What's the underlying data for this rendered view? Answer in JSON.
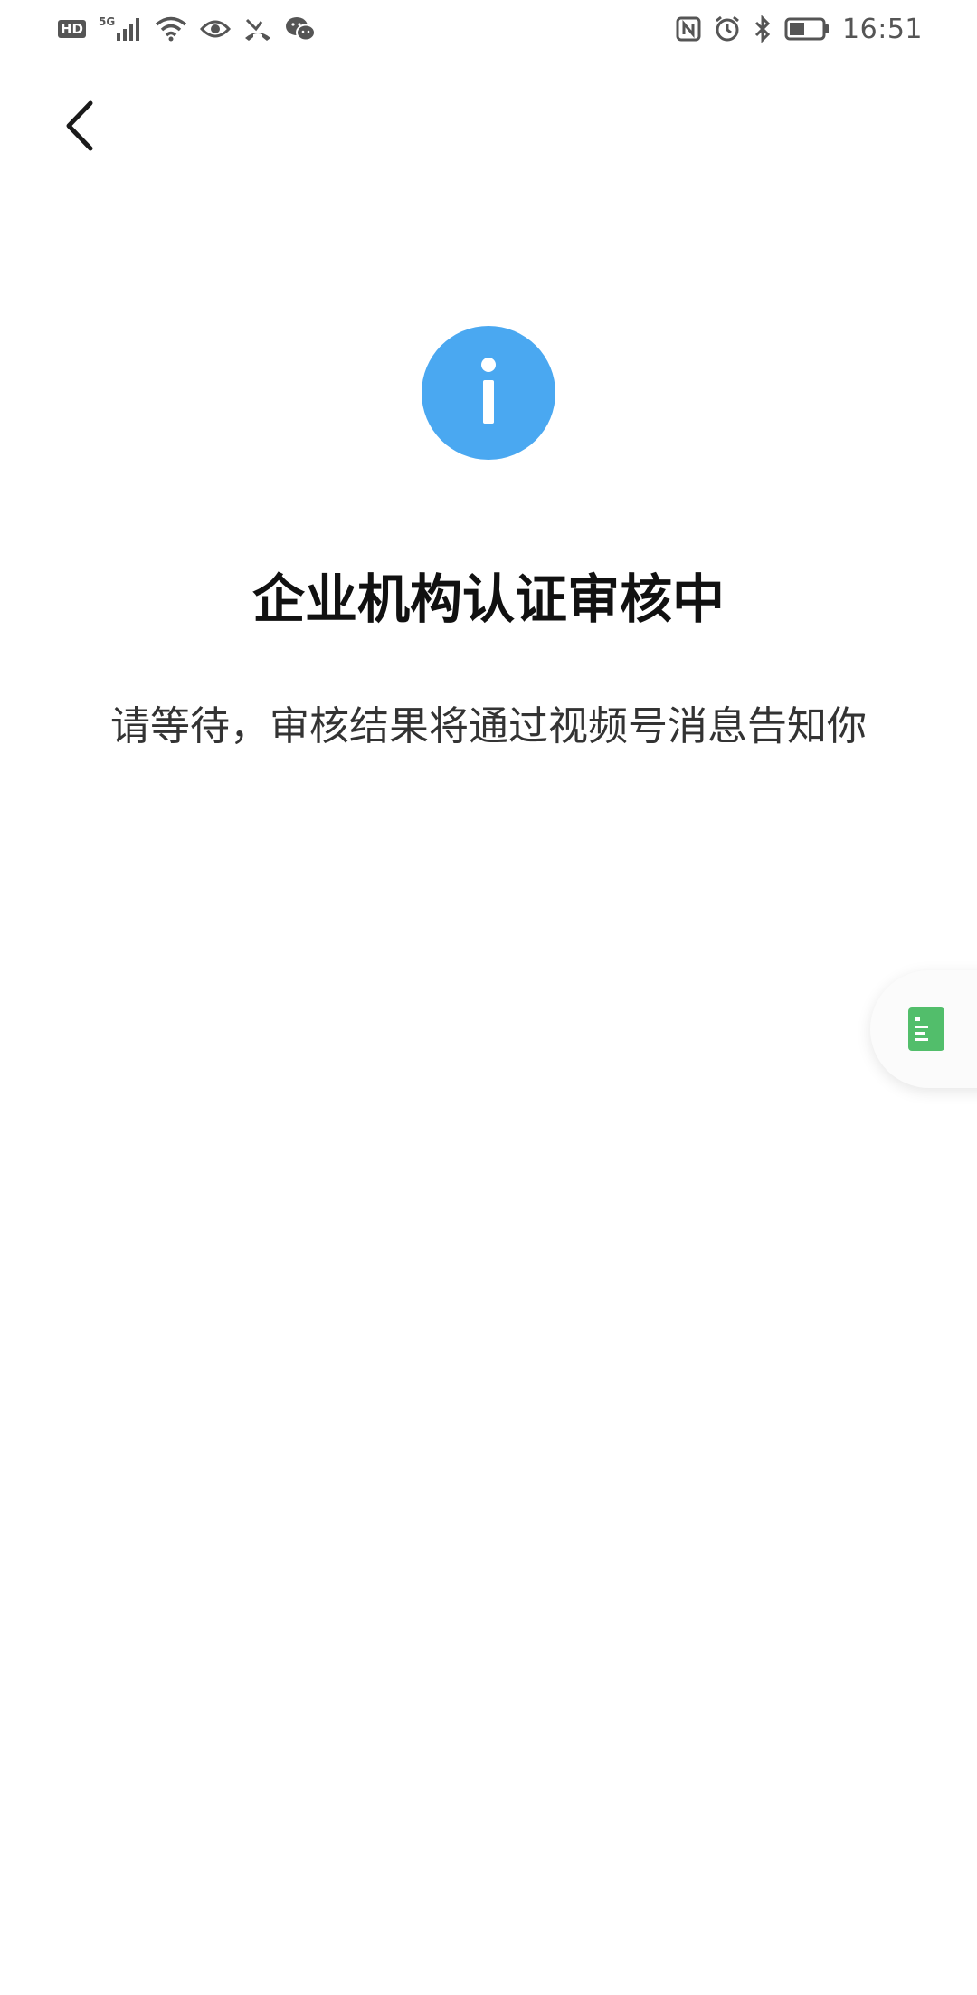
{
  "status_bar": {
    "hd_label": "HD",
    "network_label": "5G",
    "time": "16:51",
    "icons": [
      "signal-icon",
      "wifi-icon",
      "eye-icon",
      "missed-call-icon",
      "wechat-icon",
      "nfc-icon",
      "alarm-icon",
      "bluetooth-icon",
      "battery-icon"
    ]
  },
  "nav": {
    "back_icon": "chevron-left-icon"
  },
  "main": {
    "icon": "info-icon",
    "icon_color": "#4aa8f1",
    "title": "企业机构认证审核中",
    "description": "请等待，审核结果将通过视频号消息告知你"
  },
  "floating_button": {
    "icon": "document-icon",
    "icon_color": "#52be6b"
  }
}
